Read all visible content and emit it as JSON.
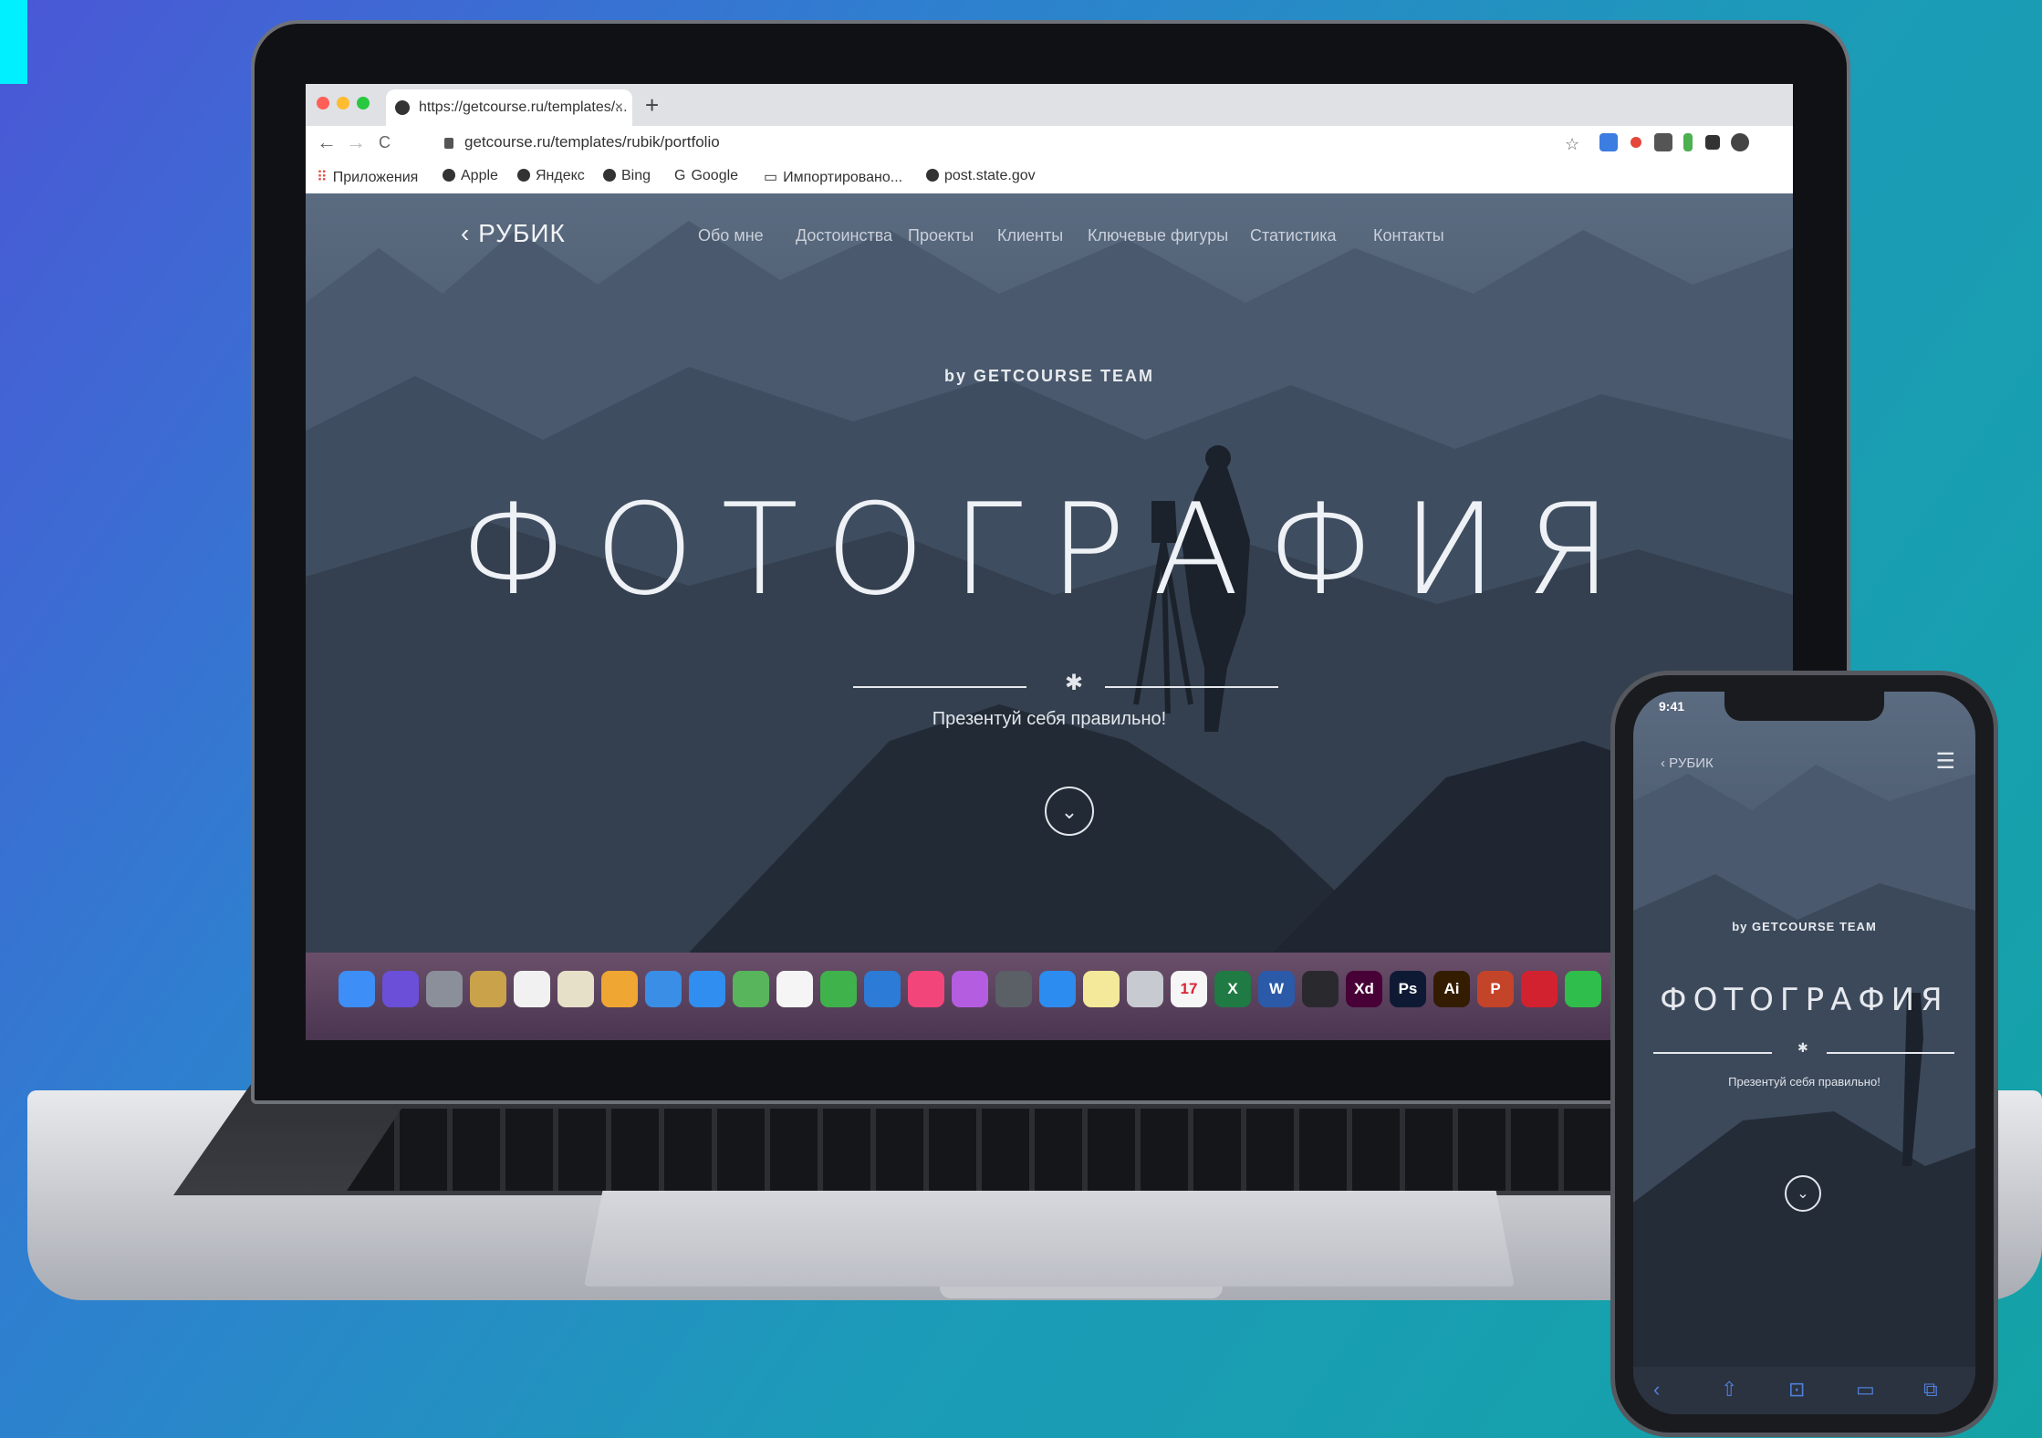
{
  "browser": {
    "tab_title": "https://getcourse.ru/templates/...",
    "tab_close": "×",
    "new_tab": "+",
    "url": "getcourse.ru/templates/rubik/portfolio",
    "nav": {
      "back": "←",
      "forward": "→",
      "reload": "C"
    },
    "bookmarks": [
      "Приложения",
      "Apple",
      "Яндекс",
      "Bing",
      "Google",
      "Импортировано...",
      "post.state.gov"
    ]
  },
  "site": {
    "logo": "‹ РУБИК",
    "nav": [
      "Обо мне",
      "Достоинства",
      "Проекты",
      "Клиенты",
      "Ключевые фигуры",
      "Статистика",
      "Контакты"
    ],
    "byline": "by GETCOURSE TEAM",
    "title": "ФОТОГРАФИЯ",
    "divider_star": "✱",
    "tagline": "Презентуй себя правильно!",
    "scroll_icon": "⌄"
  },
  "dock": {
    "apps": [
      {
        "icon": "finder-icon",
        "color": "#3e8ef7",
        "label": ""
      },
      {
        "icon": "siri-icon",
        "color": "#6b4fd8",
        "label": ""
      },
      {
        "icon": "launchpad-icon",
        "color": "#8a8f99",
        "label": ""
      },
      {
        "icon": "notes-folder-icon",
        "color": "#c9a24a",
        "label": ""
      },
      {
        "icon": "textedit-icon",
        "color": "#f1f1f1",
        "label": ""
      },
      {
        "icon": "preview-icon",
        "color": "#e7e0c8",
        "label": ""
      },
      {
        "icon": "photos-icon",
        "color": "#f0a632",
        "label": ""
      },
      {
        "icon": "mail-icon",
        "color": "#3a8ee6",
        "label": ""
      },
      {
        "icon": "safari-icon",
        "color": "#2f8ef0",
        "label": ""
      },
      {
        "icon": "maps-icon",
        "color": "#58b55c",
        "label": ""
      },
      {
        "icon": "calendar-icon",
        "color": "#f5f5f5",
        "label": ""
      },
      {
        "icon": "numbers-icon",
        "color": "#3fb24c",
        "label": ""
      },
      {
        "icon": "keynote-icon",
        "color": "#2c7bd6",
        "label": ""
      },
      {
        "icon": "music-icon",
        "color": "#f2457a",
        "label": ""
      },
      {
        "icon": "podcasts-icon",
        "color": "#b45de0",
        "label": ""
      },
      {
        "icon": "camera-icon",
        "color": "#5b5f66",
        "label": ""
      },
      {
        "icon": "appstore-icon",
        "color": "#2c8cf0",
        "label": ""
      },
      {
        "icon": "stickies-icon",
        "color": "#f4e99a",
        "label": ""
      },
      {
        "icon": "disk-utility-icon",
        "color": "#c7cad0",
        "label": ""
      },
      {
        "icon": "calendar-date-icon",
        "color": "#f6f6f6",
        "label": "17"
      },
      {
        "icon": "excel-icon",
        "color": "#1f7a44",
        "label": "X"
      },
      {
        "icon": "word-icon",
        "color": "#2a5aa8",
        "label": "W"
      },
      {
        "icon": "figma-icon",
        "color": "#2a2a2e",
        "label": ""
      },
      {
        "icon": "xd-icon",
        "color": "#470137",
        "label": "Xd"
      },
      {
        "icon": "photoshop-icon",
        "color": "#0e1a33",
        "label": "Ps"
      },
      {
        "icon": "illustrator-icon",
        "color": "#331c00",
        "label": "Ai"
      },
      {
        "icon": "powerpoint-icon",
        "color": "#c4442a",
        "label": "P"
      },
      {
        "icon": "opera-icon",
        "color": "#d3222f",
        "label": ""
      },
      {
        "icon": "whatsapp-icon",
        "color": "#2fbd4c",
        "label": ""
      }
    ]
  },
  "phone": {
    "time": "9:41",
    "logo": "‹ РУБИК",
    "menu_icon": "☰",
    "byline": "by GETCOURSE TEAM",
    "title": "ФОТОГРАФИЯ",
    "divider_star": "✱",
    "tagline": "Презентуй себя правильно!",
    "scroll_icon": "⌄",
    "toolbar": [
      "‹",
      "⇧",
      "⊡",
      "▭",
      "⧉"
    ]
  },
  "colors": {
    "accent_bar": "#00f0ff",
    "background_start": "#4b57d6",
    "background_end": "#13a3a6"
  }
}
